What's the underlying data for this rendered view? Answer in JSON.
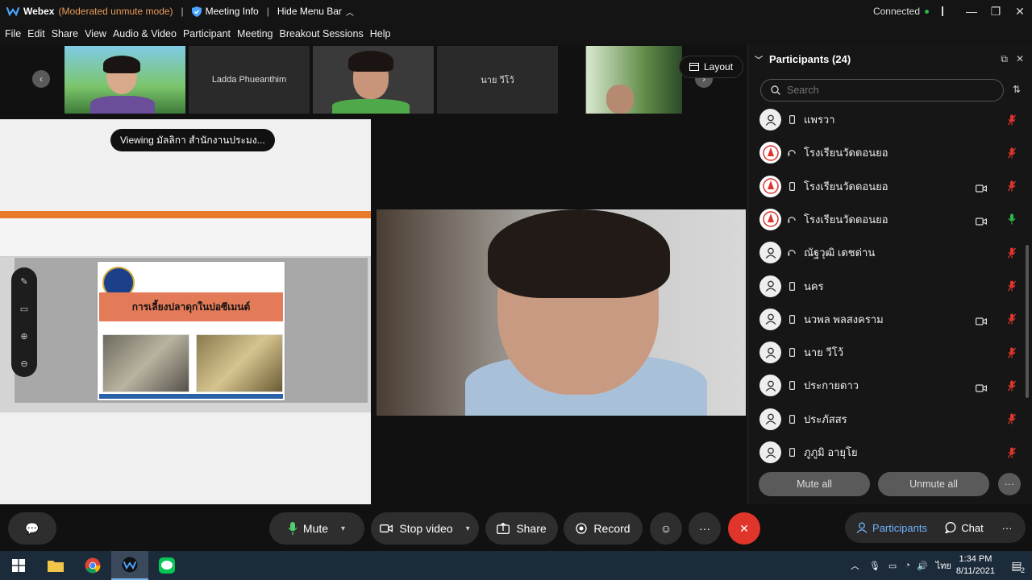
{
  "titlebar": {
    "app_name": "Webex",
    "mode": "(Moderated unmute mode)",
    "meeting_info": "Meeting Info",
    "hide_menu": "Hide Menu Bar",
    "connection": "Connected"
  },
  "menu": [
    "File",
    "Edit",
    "Share",
    "View",
    "Audio & Video",
    "Participant",
    "Meeting",
    "Breakout Sessions",
    "Help"
  ],
  "strip": {
    "tiles": [
      {
        "name": ""
      },
      {
        "name": "Ladda Phueanthim"
      },
      {
        "name": ""
      },
      {
        "name": "นาย วีโว้"
      },
      {
        "name": ""
      }
    ],
    "layout_label": "Layout"
  },
  "share": {
    "viewing_label": "Viewing มัลลิกา สำนักงานประมง...",
    "slide_title": "การเลี้ยงปลาดุกในบ่อซีเมนต์"
  },
  "panel": {
    "title": "Participants (24)",
    "search_placeholder": "Search",
    "participants": [
      {
        "name": "แพรวา",
        "avatar": "person",
        "device": "phone",
        "video": false,
        "mic": "muted"
      },
      {
        "name": "โรงเรียนวัดดอนยอ",
        "avatar": "school",
        "device": "headset",
        "video": false,
        "mic": "muted"
      },
      {
        "name": "โรงเรียนวัดดอนยอ",
        "avatar": "school",
        "device": "phone",
        "video": true,
        "mic": "muted"
      },
      {
        "name": "โรงเรียนวัดดอนยอ",
        "avatar": "school",
        "device": "headset",
        "video": true,
        "mic": "active"
      },
      {
        "name": "ณัฐวุฒิ เดชด่าน",
        "avatar": "person",
        "device": "headset",
        "video": false,
        "mic": "muted"
      },
      {
        "name": "นคร",
        "avatar": "person",
        "device": "phone",
        "video": false,
        "mic": "muted"
      },
      {
        "name": "นวพล พลสงคราม",
        "avatar": "person",
        "device": "phone",
        "video": true,
        "mic": "muted"
      },
      {
        "name": "นาย วีโว้",
        "avatar": "person",
        "device": "phone",
        "video": false,
        "mic": "muted"
      },
      {
        "name": "ประกายดาว",
        "avatar": "person",
        "device": "phone",
        "video": true,
        "mic": "muted"
      },
      {
        "name": "ประภัสสร",
        "avatar": "person",
        "device": "phone",
        "video": false,
        "mic": "muted"
      },
      {
        "name": "ภูภูมิ อายุโย",
        "avatar": "person",
        "device": "phone",
        "video": false,
        "mic": "muted"
      }
    ],
    "mute_all": "Mute all",
    "unmute_all": "Unmute all"
  },
  "controls": {
    "mute": "Mute",
    "stop_video": "Stop video",
    "share": "Share",
    "record": "Record",
    "participants": "Participants",
    "chat": "Chat"
  },
  "colors": {
    "muted_mic": "#e0352b",
    "active_mic": "#2fb84a",
    "end_button": "#e0352b",
    "mode_text": "#e89c5a",
    "participants_tab": "#6fb1ff"
  },
  "taskbar": {
    "language": "ไทย",
    "time": "1:34 PM",
    "date": "8/11/2021",
    "notification_count": "2"
  }
}
